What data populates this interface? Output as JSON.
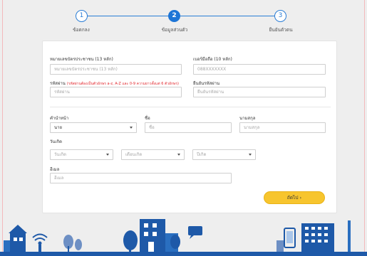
{
  "stepper": {
    "steps": [
      {
        "number": "1",
        "label": "ข้อตกลง"
      },
      {
        "number": "2",
        "label": "ข้อมูลส่วนตัว"
      },
      {
        "number": "3",
        "label": "ยืนยันตัวตน"
      }
    ]
  },
  "form": {
    "id_card": {
      "label": "หมายเลขบัตรประชาชน (13 หลัก)",
      "placeholder": "หมายเลขบัตรประชาชน (13 หลัก)"
    },
    "mobile": {
      "label": "เบอร์มือถือ (10 หลัก)",
      "placeholder": "088XXXXXXX"
    },
    "password": {
      "label": "รหัสผ่าน",
      "note": "(รหัสผ่านต้องเป็นตัวอักษร a-z, A-Z และ 0-9 ความยาวตั้งแต่ 6 ตัวอักษร)",
      "placeholder": "รหัสผ่าน"
    },
    "password_confirm": {
      "label": "ยืนยันรหัสผ่าน",
      "placeholder": "ยืนยันรหัสผ่าน"
    },
    "title": {
      "label": "คำนำหน้า",
      "value": "นาย"
    },
    "first_name": {
      "label": "ชื่อ",
      "placeholder": "ชื่อ"
    },
    "last_name": {
      "label": "นามสกุล",
      "placeholder": "นามสกุล"
    },
    "birthdate": {
      "label": "วันเกิด",
      "day": "วันเกิด",
      "month": "เดือนเกิด",
      "year": "ปีเกิด"
    },
    "email": {
      "label": "อีเมล",
      "placeholder": "อีเมล"
    },
    "next_button": "ถัดไป ›"
  },
  "colors": {
    "primary": "#1d75d6",
    "button": "#f7c52e",
    "note": "#e2262c",
    "background": "#eeeeee"
  }
}
